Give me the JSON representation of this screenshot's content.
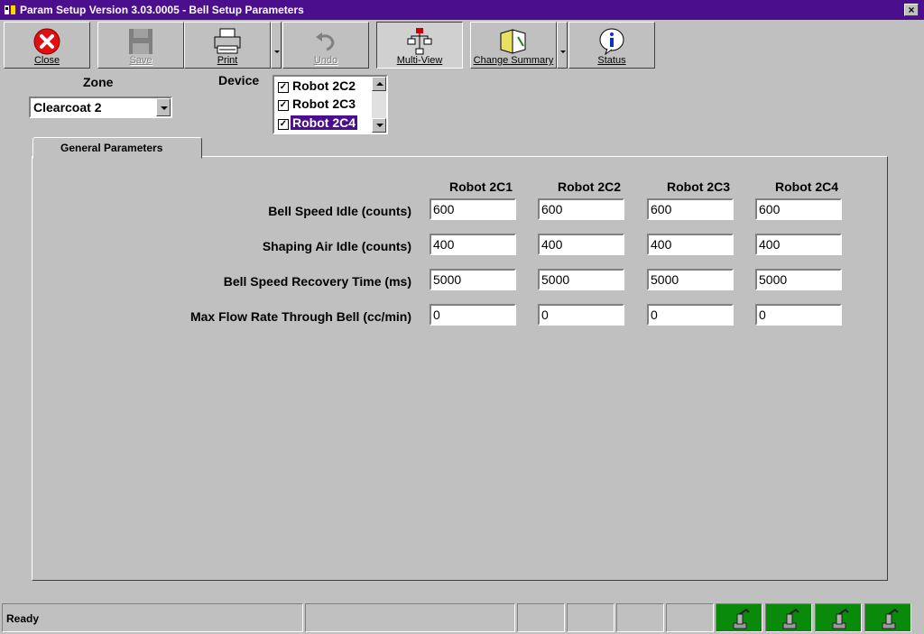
{
  "window": {
    "title": "Param Setup  Version 3.03.0005 - Bell Setup Parameters"
  },
  "toolbar": {
    "close_label": "Close",
    "save_label": "Save",
    "print_label": "Print",
    "undo_label": "Undo",
    "multiview_label": "Multi-View",
    "change_summary_label": "Change Summary",
    "status_label": "Status"
  },
  "zone": {
    "label": "Zone",
    "value": "Clearcoat 2"
  },
  "device": {
    "label": "Device",
    "items": [
      {
        "label": "Robot 2C2",
        "checked": true,
        "selected": false
      },
      {
        "label": "Robot 2C3",
        "checked": true,
        "selected": false
      },
      {
        "label": "Robot 2C4",
        "checked": true,
        "selected": true
      }
    ]
  },
  "tabs": [
    {
      "label": "General Parameters"
    }
  ],
  "grid": {
    "columns": [
      "Robot 2C1",
      "Robot 2C2",
      "Robot 2C3",
      "Robot 2C4"
    ],
    "rows": [
      {
        "label": "Bell Speed Idle (counts)",
        "values": [
          "600",
          "600",
          "600",
          "600"
        ]
      },
      {
        "label": "Shaping Air Idle (counts)",
        "values": [
          "400",
          "400",
          "400",
          "400"
        ]
      },
      {
        "label": "Bell Speed Recovery Time (ms)",
        "values": [
          "5000",
          "5000",
          "5000",
          "5000"
        ]
      },
      {
        "label": "Max Flow Rate Through Bell (cc/min)",
        "values": [
          "0",
          "0",
          "0",
          "0"
        ]
      }
    ]
  },
  "status": {
    "text": "Ready",
    "indicator_color": "#0a8a0a"
  }
}
